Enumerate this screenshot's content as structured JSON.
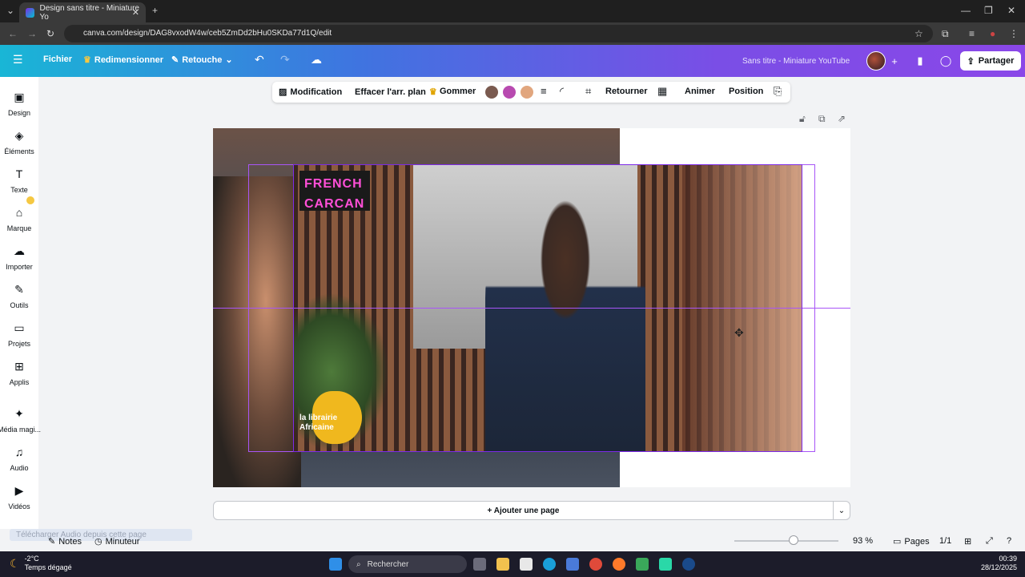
{
  "browser": {
    "tab_title": "Design sans titre - Miniature Yo",
    "url": "canva.com/design/DAG8vxodW4w/ceb5ZmDd2bHu0SKDa77d1Q/edit"
  },
  "header": {
    "file": "Fichier",
    "resize": "Redimensionner",
    "retouch": "Retouche",
    "doc_title": "Sans titre - Miniature YouTube",
    "share": "Partager"
  },
  "sidebar": {
    "items": [
      {
        "label": "Design"
      },
      {
        "label": "Éléments"
      },
      {
        "label": "Texte"
      },
      {
        "label": "Marque"
      },
      {
        "label": "Importer"
      },
      {
        "label": "Outils"
      },
      {
        "label": "Projets"
      },
      {
        "label": "Applis"
      },
      {
        "label": "Média magi..."
      },
      {
        "label": "Audio"
      },
      {
        "label": "Vidéos"
      }
    ]
  },
  "toolbar": {
    "modification": "Modification",
    "remove_bg": "Effacer l'arr. plan",
    "eraser": "Gommer",
    "swatches": [
      "#7a5a4f",
      "#b84ab0",
      "#e1a67e"
    ],
    "flip": "Retourner",
    "animate": "Animer",
    "position": "Position"
  },
  "canvas": {
    "title_line1": "FRENCH",
    "title_line2": "CARCAN",
    "logo_line1": "la librairie",
    "logo_line2": "Africaine"
  },
  "add_page": "+ Ajouter une page",
  "bottom": {
    "audio_download": "Télécharger Audio depuis cette page",
    "notes": "Notes",
    "timer": "Minuteur",
    "zoom": "93 %",
    "pages": "Pages",
    "page_count": "1/1"
  },
  "taskbar": {
    "temp": "-2°C",
    "weather": "Temps dégagé",
    "search": "Rechercher",
    "time": "00:39",
    "date": "28/12/2025"
  }
}
